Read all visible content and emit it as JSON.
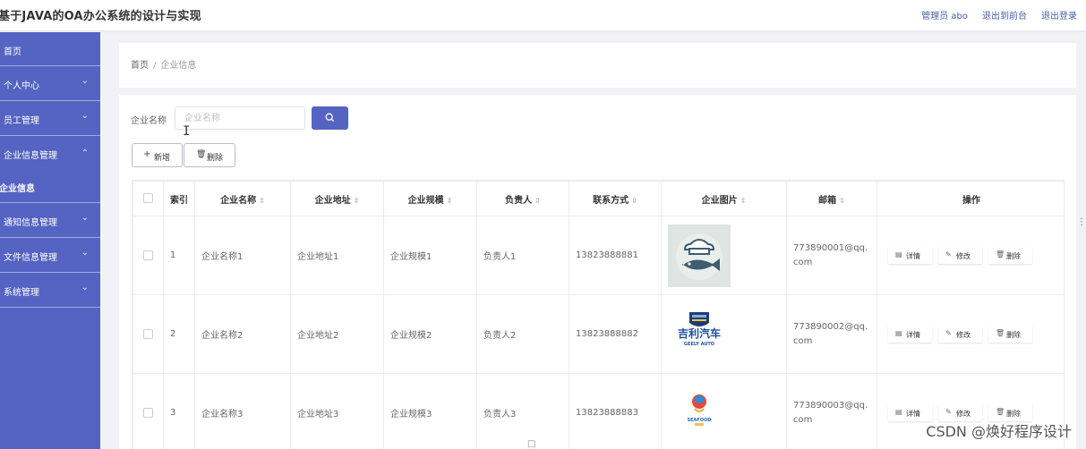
{
  "header": {
    "title": "基于JAVA的OA办公系统的设计与实现",
    "admin": "管理员 abo",
    "to_front": "退出到前台",
    "logout": "退出登录"
  },
  "sidebar": {
    "items": [
      {
        "label": "首页",
        "has_chevron": false
      },
      {
        "label": "个人中心",
        "has_chevron": true
      },
      {
        "label": "员工管理",
        "has_chevron": true
      },
      {
        "label": "企业信息管理",
        "has_chevron": true,
        "expanded": true
      },
      {
        "label": "企业信息",
        "submenu": true
      },
      {
        "label": "通知信息管理",
        "has_chevron": true
      },
      {
        "label": "文件信息管理",
        "has_chevron": true
      },
      {
        "label": "系统管理",
        "has_chevron": true
      }
    ]
  },
  "breadcrumb": {
    "home": "首页",
    "separator": "/",
    "current": "企业信息"
  },
  "search": {
    "label": "企业名称",
    "placeholder": "企业名称",
    "value": ""
  },
  "toolbar": {
    "add_label": "新增",
    "delete_label": "删除"
  },
  "table": {
    "columns": [
      "索引",
      "企业名称",
      "企业地址",
      "企业规模",
      "负责人",
      "联系方式",
      "企业图片",
      "邮箱",
      "操作"
    ],
    "rows": [
      {
        "index": "1",
        "name": "企业名称1",
        "address": "企业地址1",
        "scale": "企业规模1",
        "leader": "负责人1",
        "phone": "13823888881",
        "image": "chef-fish-logo",
        "email": "773890001@qq.com"
      },
      {
        "index": "2",
        "name": "企业名称2",
        "address": "企业地址2",
        "scale": "企业规模2",
        "leader": "负责人2",
        "phone": "13823888882",
        "image": "geely-auto-logo",
        "image_text": "吉利汽车",
        "image_subtext": "GEELY AUTO",
        "email": "773890002@qq.com"
      },
      {
        "index": "3",
        "name": "企业名称3",
        "address": "企业地址3",
        "scale": "企业规模3",
        "leader": "负责人3",
        "phone": "13823888883",
        "image": "seafood-logo",
        "image_text": "SEAFOOD",
        "email": "773890003@qq.com"
      }
    ],
    "actions": {
      "detail": "详情",
      "edit": "修改",
      "delete": "删除"
    }
  },
  "watermark": "CSDN @焕好程序设计",
  "colors": {
    "sidebar": "#5563c2",
    "accent": "#5563c2",
    "link": "#4b5fa8"
  }
}
